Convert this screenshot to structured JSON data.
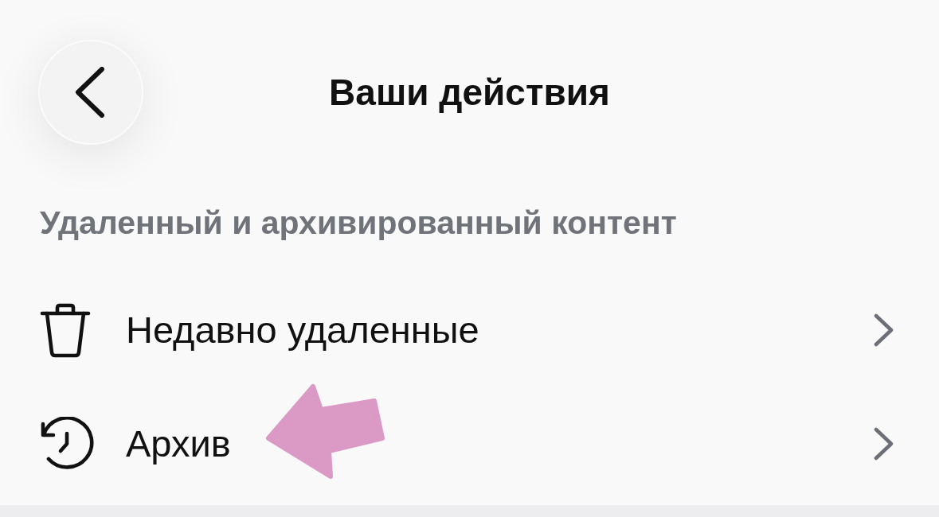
{
  "header": {
    "title": "Ваши действия"
  },
  "section": {
    "title": "Удаленный и архивированный контент",
    "items": [
      {
        "kind": "trash",
        "label": "Недавно удаленные",
        "pointed_at": false
      },
      {
        "kind": "history",
        "label": "Архив",
        "pointed_at": true
      }
    ]
  }
}
